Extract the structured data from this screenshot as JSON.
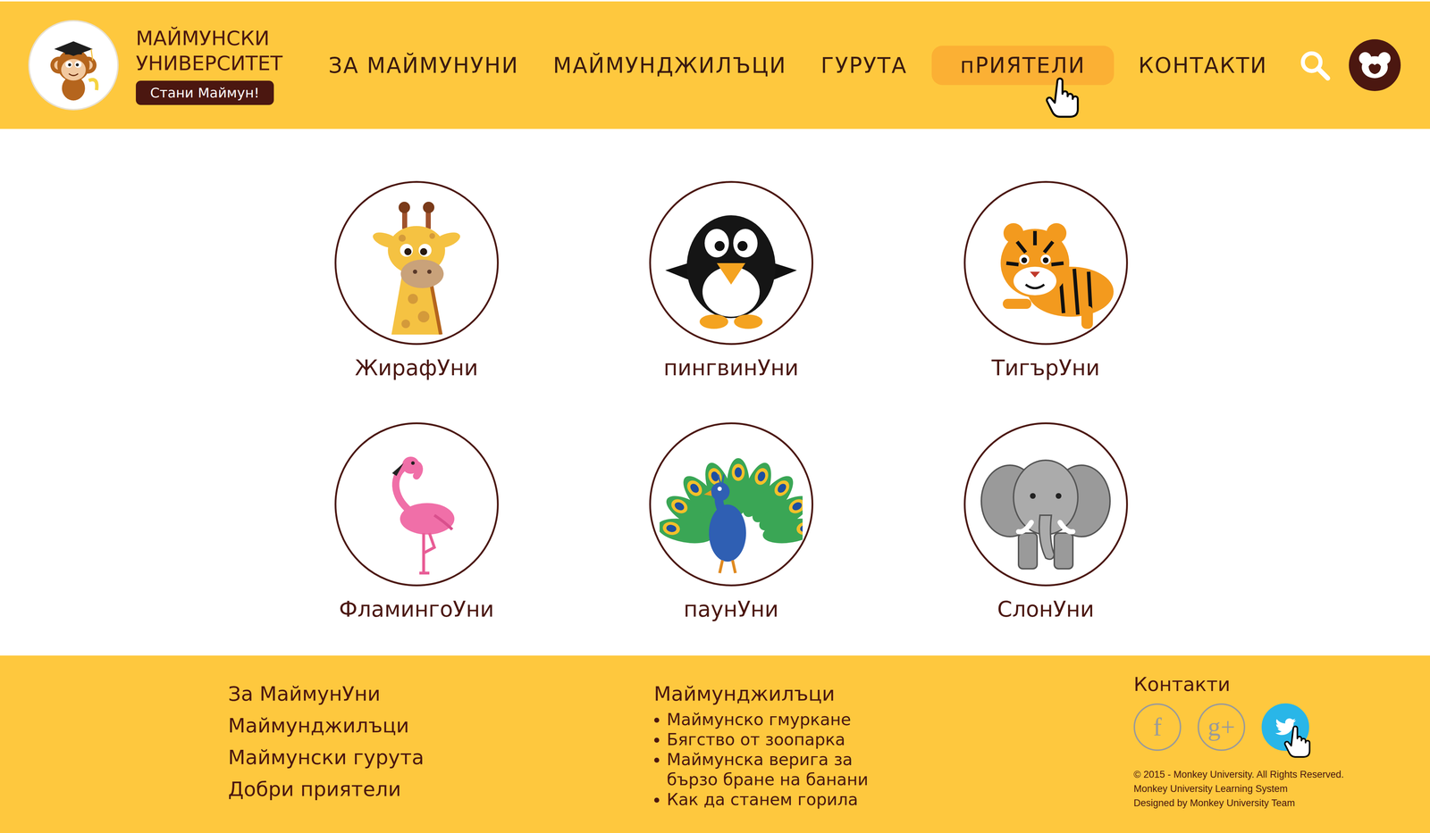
{
  "brand": {
    "title_lines": [
      "МАЙМУНСКИ",
      "УНИВЕРСИТЕТ"
    ],
    "cta": "Стани Маймун!"
  },
  "nav": [
    {
      "label": "ЗА МАЙМУНУНИ",
      "selected": false
    },
    {
      "label": "МАЙМУНДЖИЛЪЦИ",
      "selected": false
    },
    {
      "label": "ГУРУТА",
      "selected": false
    },
    {
      "label": "пРИЯТЕЛИ",
      "selected": true
    },
    {
      "label": "КОНТАКТИ",
      "selected": false
    }
  ],
  "friends": [
    {
      "name": "ЖирафУни",
      "kind": "giraffe"
    },
    {
      "name": "пингвинУни",
      "kind": "penguin"
    },
    {
      "name": "ТигърУни",
      "kind": "tiger"
    },
    {
      "name": "ФламингоУни",
      "kind": "flamingo"
    },
    {
      "name": "паунУни",
      "kind": "peacock"
    },
    {
      "name": "СлонУни",
      "kind": "elephant"
    }
  ],
  "footer": {
    "links": [
      "За МаймунУни",
      "Маймунджилъци",
      "Маймунски гурута",
      "Добри приятели"
    ],
    "section": {
      "title": "Маймунджилъци",
      "items": [
        {
          "lines": [
            "Маймунско гмуркане"
          ]
        },
        {
          "lines": [
            "Бягство от зоопарка"
          ]
        },
        {
          "lines": [
            "Маймунска верига за",
            "бързо бране на банани"
          ]
        },
        {
          "lines": [
            "Как да станем горила"
          ]
        }
      ]
    },
    "contacts": {
      "title": "Контакти",
      "social": [
        {
          "kind": "facebook",
          "glyph": "f",
          "selected": false
        },
        {
          "kind": "google-plus",
          "glyph": "g+",
          "selected": false
        },
        {
          "kind": "twitter",
          "glyph": "",
          "selected": true
        }
      ]
    },
    "copyright": [
      "© 2015 - Monkey University. All Rights Reserved.",
      "Monkey University Learning System",
      "Designed by Monkey University Team"
    ]
  }
}
